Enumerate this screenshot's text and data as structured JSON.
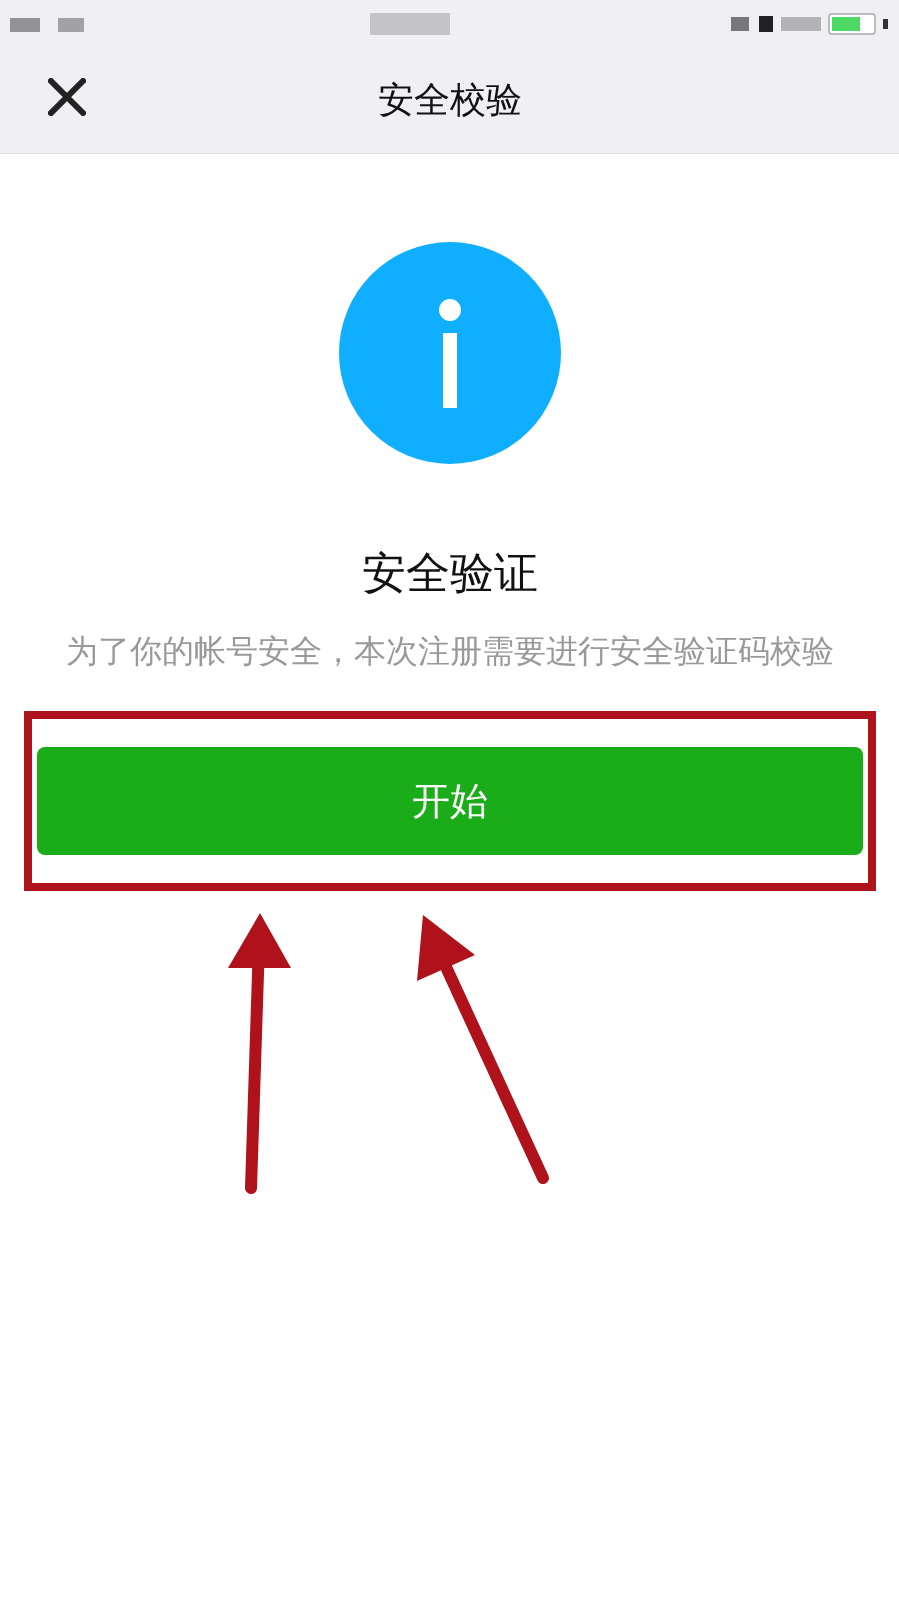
{
  "nav_bar": {
    "title": "安全校验"
  },
  "notice": {
    "heading": "安全验证",
    "description": "为了你的帐号安全，本次注册需要进行安全验证码校验"
  },
  "buttons": [
    {
      "label": "开始"
    }
  ]
}
